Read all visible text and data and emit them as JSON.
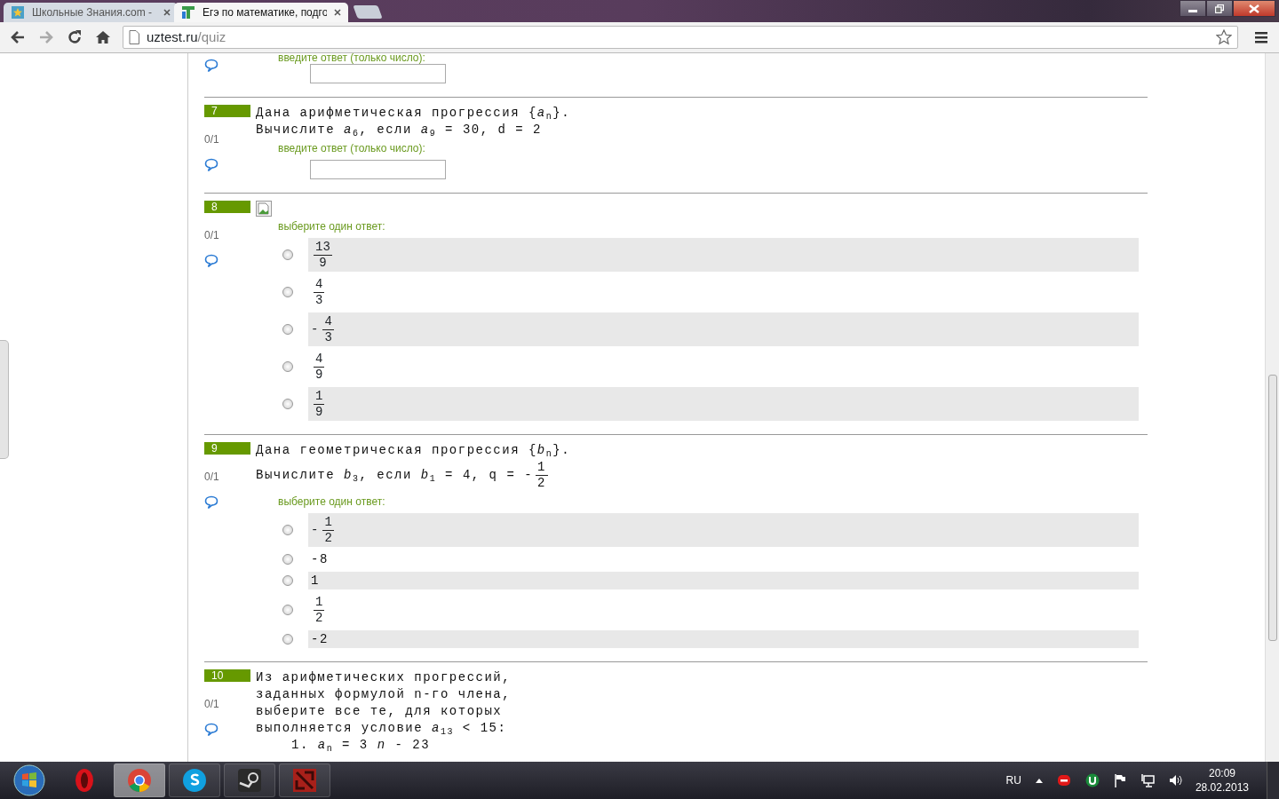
{
  "browser": {
    "tabs": [
      {
        "title": "Школьные Знания.com -",
        "selected": false
      },
      {
        "title": "Егэ по математике, подго",
        "selected": true
      }
    ],
    "url": {
      "host": "uztest.ru",
      "path": "/quiz"
    }
  },
  "partial_question": {
    "prompt": "введите ответ (только число):"
  },
  "questions": [
    {
      "number": "7",
      "score": "0/1",
      "kind": "input",
      "lines": [
        {
          "kind": "text",
          "text": "Дана арифметическая прогрессия {*a*$_{n}$}."
        },
        {
          "kind": "text",
          "text": "Вычислите *a*$_{6}$, если *a*$_{9}$ = 30, d = 2"
        }
      ],
      "prompt": "введите ответ (только число):"
    },
    {
      "number": "8",
      "score": "0/1",
      "kind": "choice",
      "image": true,
      "prompt": "выберите один ответ:",
      "options": [
        {
          "kind": "fraction",
          "numerator": "13",
          "denominator": "9",
          "selected": false
        },
        {
          "kind": "fraction",
          "numerator": "4",
          "denominator": "3",
          "selected": false
        },
        {
          "kind": "fraction",
          "sign": "-",
          "numerator": "4",
          "denominator": "3",
          "selected": false
        },
        {
          "kind": "fraction",
          "numerator": "4",
          "denominator": "9",
          "selected": false
        },
        {
          "kind": "fraction",
          "numerator": "1",
          "denominator": "9",
          "selected": false
        }
      ]
    },
    {
      "number": "9",
      "score": "0/1",
      "kind": "choice",
      "lines": [
        {
          "kind": "text",
          "text": "Дана геометрическая прогрессия {*b*$_{n}$}."
        },
        {
          "kind": "text",
          "text": "Вычислите *b*$_{3}$, если *b*$_{1}$ = 4, q = -",
          "fraction": {
            "numerator": "1",
            "denominator": "2"
          }
        }
      ],
      "prompt": "выберите один ответ:",
      "options": [
        {
          "kind": "fraction",
          "sign": "-",
          "numerator": "1",
          "denominator": "2",
          "selected": false
        },
        {
          "kind": "text",
          "text": "-8",
          "selected": false
        },
        {
          "kind": "text",
          "text": "1",
          "selected": false
        },
        {
          "kind": "fraction",
          "numerator": "1",
          "denominator": "2",
          "selected": false
        },
        {
          "kind": "text",
          "text": "-2",
          "selected": false
        }
      ]
    },
    {
      "number": "10",
      "score": "0/1",
      "kind": "text",
      "lines": [
        {
          "kind": "text",
          "text": "Из арифметических прогрессий,"
        },
        {
          "kind": "text",
          "text": "заданных формулой n-го члена,"
        },
        {
          "kind": "text",
          "text": "выберите все те, для которых"
        },
        {
          "kind": "text",
          "text": "выполняется условие *a*$_{13}$ < 15:"
        },
        {
          "kind": "item",
          "text": "1. *a*$_{n}$ = 3 *n* - 23"
        }
      ]
    }
  ],
  "taskbar": {
    "apps": [
      {
        "kind": "opera",
        "selected": false
      },
      {
        "kind": "chrome",
        "selected": true
      },
      {
        "kind": "skype",
        "selected": false
      },
      {
        "kind": "steam",
        "selected": false
      },
      {
        "kind": "dota",
        "selected": false
      }
    ],
    "language": "RU",
    "time": "20:09",
    "date": "28.02.2013"
  }
}
